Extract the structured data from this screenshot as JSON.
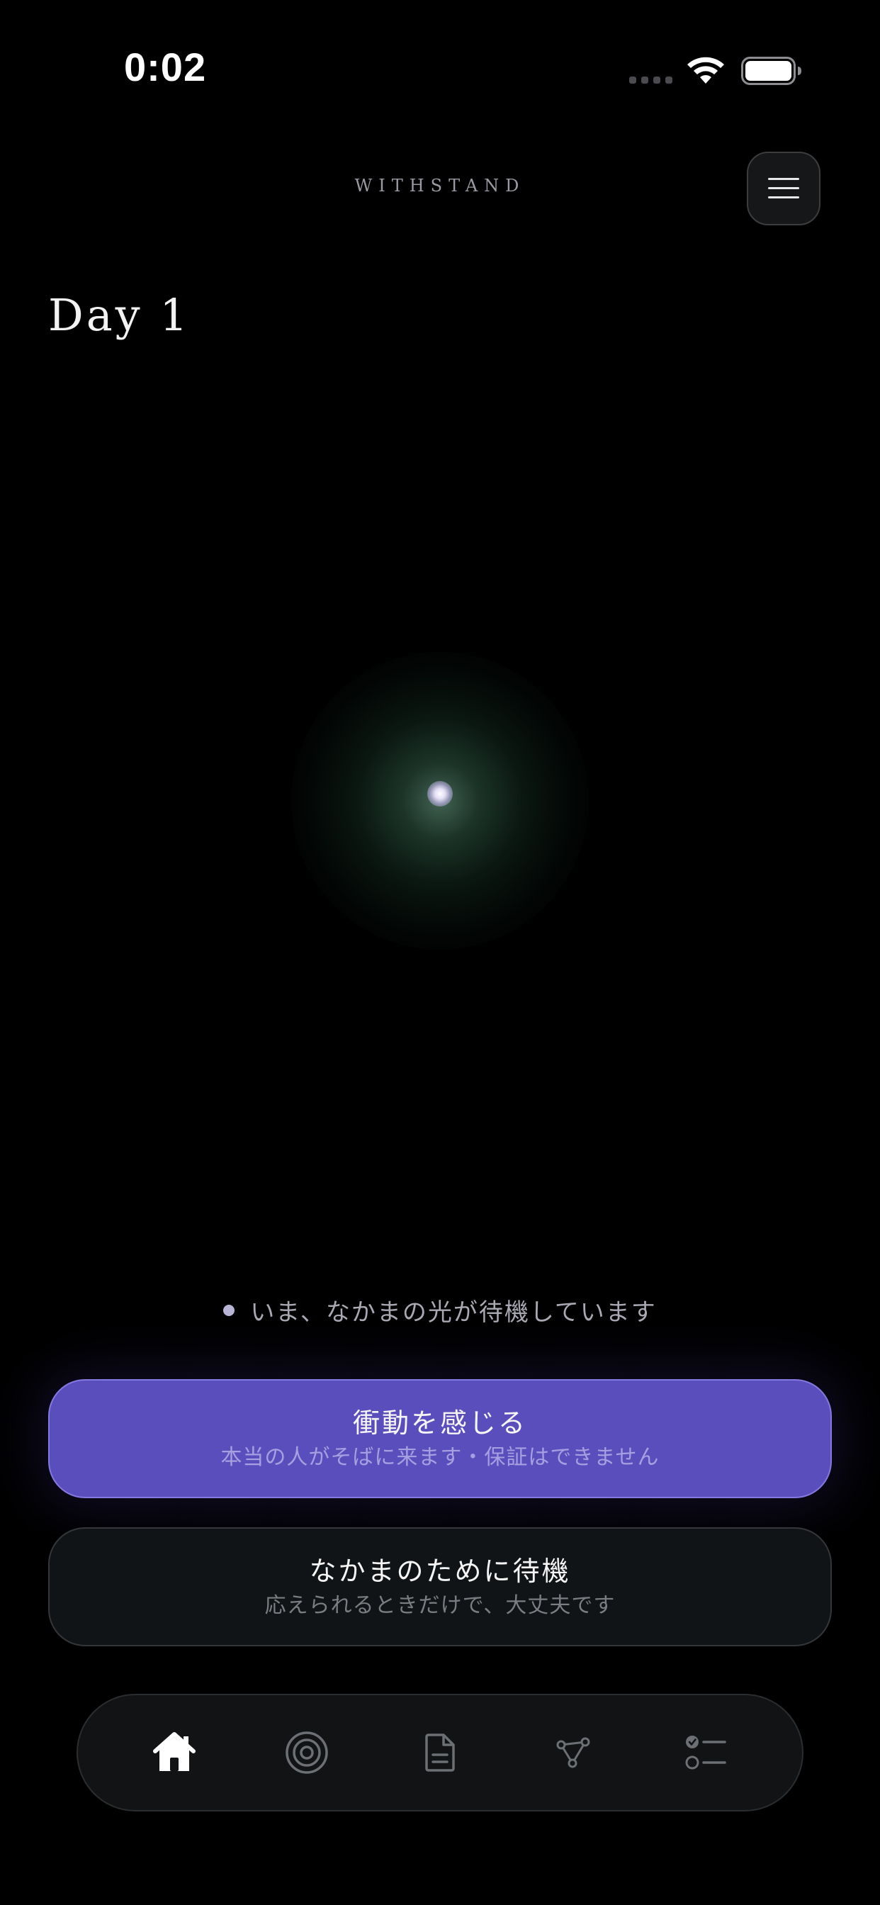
{
  "status_bar": {
    "time": "0:02",
    "icons": [
      "cellular-signal-icon",
      "wifi-icon",
      "battery-icon"
    ]
  },
  "header": {
    "app_title": "WITHSTAND",
    "menu_icon": "hamburger-menu-icon"
  },
  "main": {
    "day_label": "Day 1",
    "waiting_status": "いま、なかまの光が待機しています"
  },
  "actions": {
    "feel_impulse": {
      "title": "衝動を感じる",
      "subtitle": "本当の人がそばに来ます・保証はできません"
    },
    "wait_for_companion": {
      "title": "なかまのために待機",
      "subtitle": "応えられるときだけで、大丈夫です"
    }
  },
  "tab_bar": {
    "active_tab": "home",
    "tabs": [
      {
        "id": "home",
        "icon": "home-icon"
      },
      {
        "id": "target",
        "icon": "target-icon"
      },
      {
        "id": "document",
        "icon": "document-icon"
      },
      {
        "id": "network",
        "icon": "network-icon"
      },
      {
        "id": "checklist",
        "icon": "checklist-icon"
      }
    ]
  },
  "colors": {
    "background": "#000000",
    "accent_purple": "#5a4ebd",
    "glow_green": "#4f8f6f",
    "secondary_button": "#111416"
  }
}
